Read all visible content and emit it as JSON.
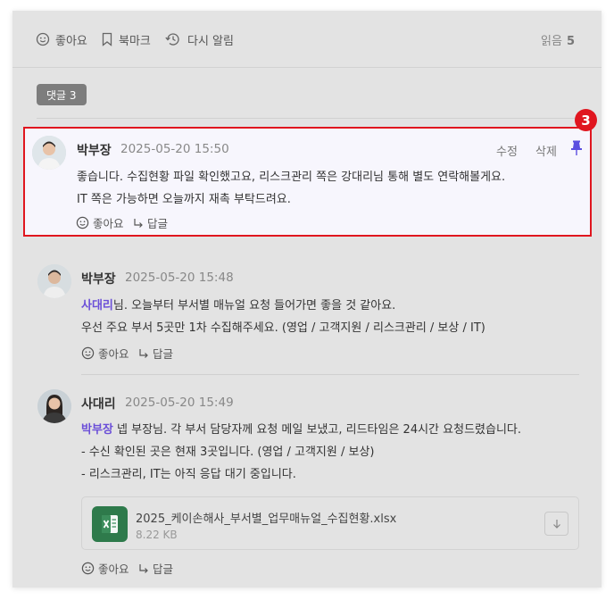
{
  "toolbar": {
    "like_label": "좋아요",
    "bookmark_label": "북마크",
    "remind_label": "다시 알림",
    "read_label": "읽음",
    "read_count": "5"
  },
  "comments_badge": "댓글 3",
  "highlight_marker": "3",
  "comments": [
    {
      "author": "박부장",
      "date": "2025-05-20 15:50",
      "lines": [
        "좋습니다. 수집현황 파일 확인했고요, 리스크관리 쪽은 강대리님 통해 별도 연락해볼게요.",
        "IT 쪽은 가능하면 오늘까지 재촉 부탁드려요."
      ],
      "edit_label": "수정",
      "delete_label": "삭제",
      "like_label": "좋아요",
      "reply_label": "답글"
    },
    {
      "author": "박부장",
      "date": "2025-05-20 15:48",
      "mention": "사대리",
      "line1_rest": "님. 오늘부터 부서별 매뉴얼 요청 들어가면 좋을 것 같아요.",
      "line2": "우선 주요 부서 5곳만 1차 수집해주세요. (영업 / 고객지원 / 리스크관리 / 보상 / IT)",
      "like_label": "좋아요",
      "reply_label": "답글"
    },
    {
      "author": "사대리",
      "date": "2025-05-20 15:49",
      "mention": "박부장",
      "line1_rest": " 넵 부장님. 각 부서 담당자께 요청 메일 보냈고, 리드타임은 24시간 요청드렸습니다.",
      "line2": "- 수신 확인된 곳은 현재 3곳입니다. (영업 / 고객지원 / 보상)",
      "line3": "- 리스크관리, IT는 아직 응답 대기 중입니다.",
      "attachment": {
        "file_name": "2025_케이손해사_부서별_업무매뉴얼_수집현황.xlsx",
        "file_size": "8.22 KB",
        "icon": "excel-file-icon"
      },
      "like_label": "좋아요",
      "reply_label": "답글"
    }
  ],
  "colors": {
    "mention": "#6b4fd8",
    "highlight_border": "#e0161f",
    "pin": "#5b4fe0",
    "excel": "#2e7a4b"
  }
}
